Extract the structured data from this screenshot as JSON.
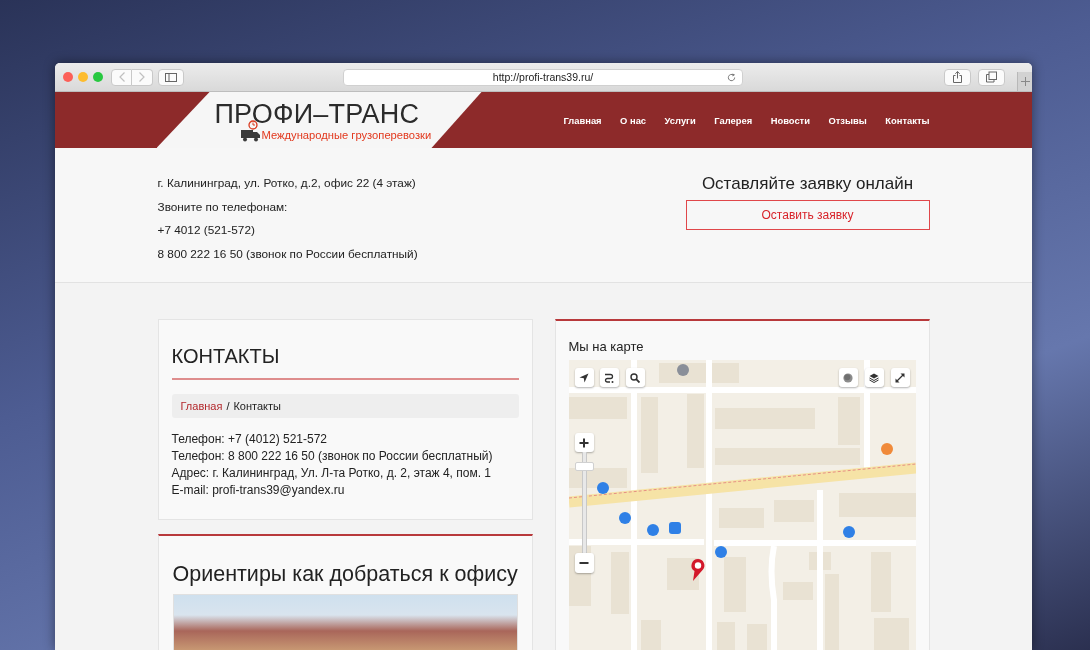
{
  "browser": {
    "nav_buttons": [
      {
        "kind": "back",
        "disabled": true
      },
      {
        "kind": "forward",
        "disabled": true
      }
    ],
    "url": "http://profi-trans39.ru/"
  },
  "header": {
    "logo": {
      "title": "ПРОФИ–ТРАНС",
      "tagline": "Международные грузоперевозки"
    },
    "nav": [
      {
        "label": "Главная"
      },
      {
        "label": "О нас"
      },
      {
        "label": "Услуги"
      },
      {
        "label": "Галерея"
      },
      {
        "label": "Новости"
      },
      {
        "label": "Отзывы"
      },
      {
        "label": "Контакты"
      }
    ]
  },
  "info": {
    "lines": [
      "г. Калининград, ул. Ротко, д.2, офис 22 (4 этаж)",
      "Звоните по телефонам:",
      "+7 4012 (521-572)",
      "8 800 222 16 50 (звонок по России бесплатный)"
    ],
    "cta": {
      "heading": "Оставляйте заявку онлайн",
      "button": "Оставить заявку"
    }
  },
  "contacts_card": {
    "title": "КОНТАКТЫ",
    "breadcrumb": {
      "items": [
        {
          "label": "Главная",
          "kind": "link"
        },
        {
          "label": "Контакты",
          "kind": "current"
        }
      ],
      "separator": "/"
    },
    "lines": [
      "Телефон: +7 (4012) 521-572",
      "Телефон: 8 800 222 16 50 (звонок по России бесплатный)",
      "Адрес: г. Калининград, Ул. Л-та Ротко, д. 2, этаж 4, пом. 1",
      "E-mail: profi-trans39@yandex.ru"
    ]
  },
  "directions_card": {
    "title": "Ориентиры как добраться к офису"
  },
  "map_card": {
    "title": "Мы на карте",
    "zoom": {
      "level": 0.89
    }
  }
}
